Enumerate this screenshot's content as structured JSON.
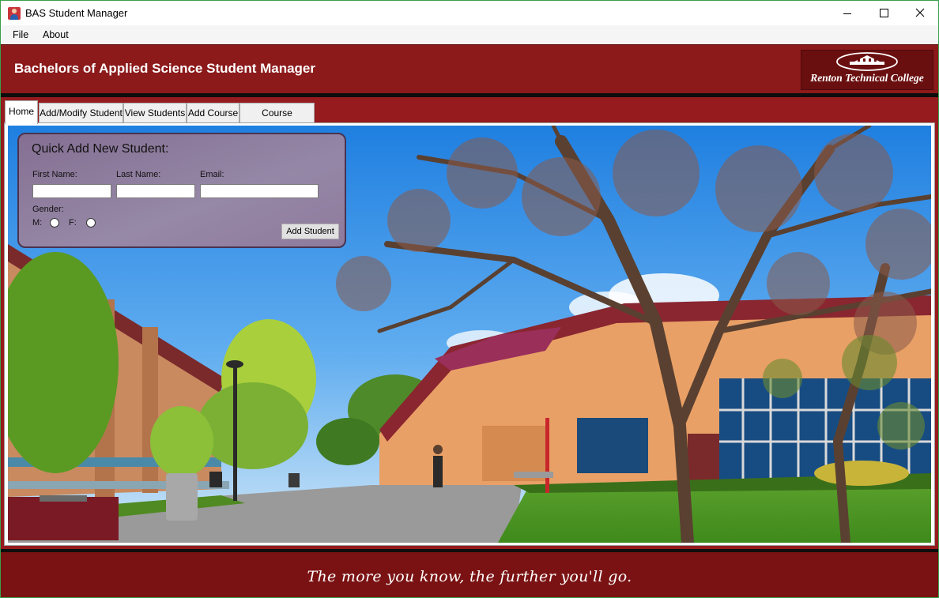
{
  "window": {
    "title": "BAS Student Manager",
    "icon": "student-app-icon",
    "controls": [
      "minimize-icon",
      "maximize-icon",
      "close-icon"
    ]
  },
  "menu": {
    "items": [
      "File",
      "About"
    ]
  },
  "header": {
    "title": "Bachelors of Applied Science Student Manager",
    "logo_text": "Renton Technical College"
  },
  "tabs": [
    "Home",
    "Add/Modify Student",
    "View Students",
    "Add Course",
    "Course Enrollment"
  ],
  "active_tab": "Home",
  "quick_add": {
    "title": "Quick Add New Student:",
    "first_name_label": "First Name:",
    "last_name_label": "Last Name:",
    "email_label": "Email:",
    "first_name_value": "",
    "last_name_value": "",
    "email_value": "",
    "gender_label": "Gender:",
    "male_label": "M:",
    "female_label": "F:",
    "submit_label": "Add Student"
  },
  "footer": {
    "tagline": "The more you know, the further you'll go."
  },
  "colors": {
    "brand_maroon": "#8c1a1b",
    "content_red": "#951b1e",
    "footer_maroon": "#7a1213",
    "panel_purple": "#8c6e8c"
  }
}
